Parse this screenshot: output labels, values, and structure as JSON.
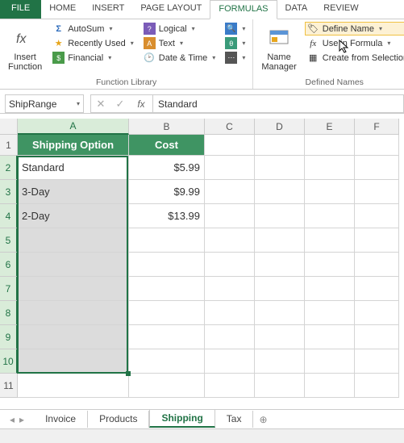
{
  "tabs": {
    "file": "FILE",
    "home": "HOME",
    "insert": "INSERT",
    "pagelayout": "PAGE LAYOUT",
    "formulas": "FORMULAS",
    "data": "DATA",
    "review": "REVIEW"
  },
  "ribbon": {
    "insert_function": "Insert\nFunction",
    "autosum": "AutoSum",
    "recently_used": "Recently Used",
    "financial": "Financial",
    "logical": "Logical",
    "text": "Text",
    "date_time": "Date & Time",
    "function_library": "Function Library",
    "name_manager": "Name\nManager",
    "define_name": "Define Name",
    "use_in_formula": "Use in Formula",
    "create_from_selection": "Create from Selection",
    "defined_names": "Defined Names"
  },
  "name_box": "ShipRange",
  "formula_value": "Standard",
  "columns": [
    "A",
    "B",
    "C",
    "D",
    "E",
    "F"
  ],
  "row_headers": [
    "1",
    "2",
    "3",
    "4",
    "5",
    "6",
    "7",
    "8",
    "9",
    "10",
    "11"
  ],
  "table": {
    "header": {
      "a": "Shipping Option",
      "b": "Cost"
    },
    "rows": [
      {
        "a": "Standard",
        "b": "$5.99"
      },
      {
        "a": "3-Day",
        "b": "$9.99"
      },
      {
        "a": "2-Day",
        "b": "$13.99"
      }
    ]
  },
  "sheets": {
    "invoice": "Invoice",
    "products": "Products",
    "shipping": "Shipping",
    "tax": "Tax"
  }
}
